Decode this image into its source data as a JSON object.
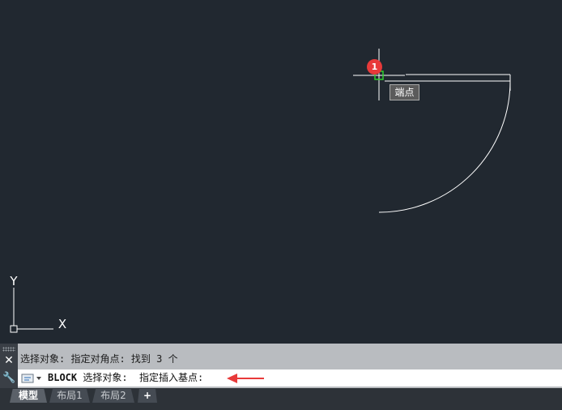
{
  "canvas": {
    "background": "#212830",
    "line_color": "#ffffff",
    "snap_color": "#2fd02f",
    "ucs": {
      "y_label": "Y",
      "x_label": "X"
    }
  },
  "osnap": {
    "tooltip": "端点",
    "badge": "1",
    "badge_color": "#e83a3a"
  },
  "command": {
    "history": "选择对象: 指定对角点: 找到 3 个",
    "command_name": "BLOCK",
    "prompt": "选择对象:  指定插入基点:",
    "arrow_color": "#e83a3a"
  },
  "tabs": [
    {
      "label": "模型"
    },
    {
      "label": "布局1"
    },
    {
      "label": "布局2"
    },
    {
      "label": "+"
    }
  ]
}
